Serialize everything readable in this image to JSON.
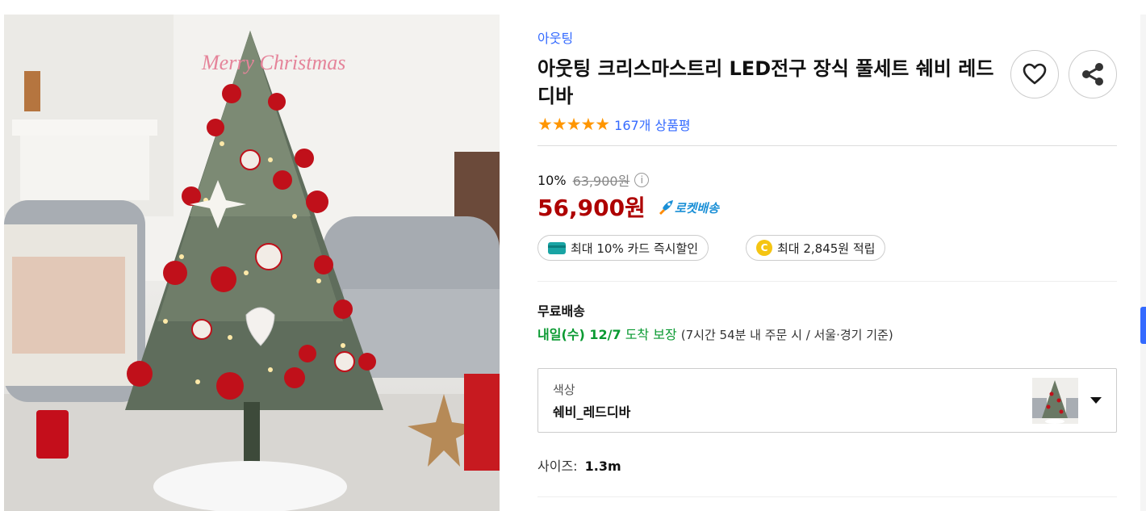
{
  "product_image": {
    "alt": "",
    "signage_text": "Merry Christmas"
  },
  "brand": "아웃팅",
  "title": "아웃팅 크리스마스트리 LED전구 장식 풀세트 쉐비 레드디바",
  "actions": {
    "wishlist_icon": "heart-icon",
    "share_icon": "share-icon"
  },
  "rating": {
    "stars": "★★★★★",
    "stars_value": 5,
    "review_count": "167개 상품평"
  },
  "price": {
    "discount_rate": "10%",
    "original_price": "63,900원",
    "info_icon": "i",
    "sale_price": "56,900원",
    "rocket_label": "로켓배송"
  },
  "benefits": [
    {
      "icon": "card-icon",
      "label": "최대 10% 카드 즉시할인"
    },
    {
      "icon": "coin-icon",
      "icon_text": "C",
      "label": "최대 2,845원 적립"
    }
  ],
  "shipping": {
    "title": "무료배송",
    "date": "내일(수) 12/7",
    "guarantee": "도착 보장",
    "note": "(7시간 54분  내 주문 시 / 서울·경기 기준)"
  },
  "option": {
    "label": "색상",
    "value": "쉐비_레드디바"
  },
  "size": {
    "label": "사이즈:",
    "value": "1.3m"
  },
  "colors": {
    "brand_blue": "#346aff",
    "sale_red": "#ae0000",
    "star_orange": "#ff9600",
    "delivery_green": "#0a9a32"
  }
}
